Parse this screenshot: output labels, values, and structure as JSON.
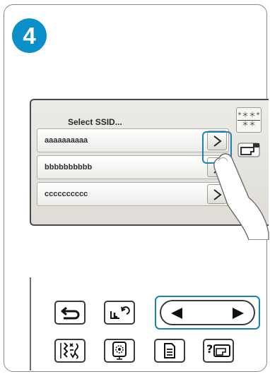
{
  "step": {
    "number": "4",
    "color": "#0a8fc9"
  },
  "screen": {
    "title": "Select SSID...",
    "networks": [
      {
        "ssid": "aaaaaaaaaa"
      },
      {
        "ssid": "bbbbbbbbbb"
      },
      {
        "ssid": "cccccccccc"
      }
    ],
    "password_icon": {
      "line1": "*＊＊*",
      "line2": "＊＊"
    }
  },
  "panel": {
    "buttons": [
      {
        "icon": "back-arrow-icon"
      },
      {
        "icon": "presser-foot-rotate-icon"
      },
      {
        "icon": "left-arrow-icon"
      },
      {
        "icon": "right-arrow-icon"
      },
      {
        "icon": "stitch-pattern-icon"
      },
      {
        "icon": "embroidery-icon"
      },
      {
        "icon": "document-icon"
      },
      {
        "icon": "help-machine-icon"
      }
    ],
    "highlight_color": "#1f7fb8"
  }
}
